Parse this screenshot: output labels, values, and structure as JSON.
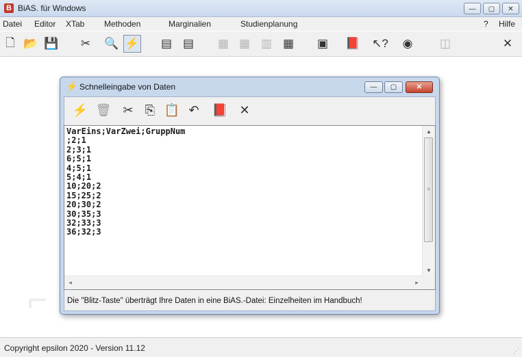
{
  "window": {
    "title": "BiAS. für Windows",
    "icon": "bias-app-icon",
    "icon_glyph": "B",
    "controls": {
      "minimize": "—",
      "maximize": "▢",
      "close": "✕"
    }
  },
  "menu": {
    "items": [
      {
        "label": "Datei"
      },
      {
        "label": "Editor"
      },
      {
        "label": "XTab"
      },
      {
        "label": "Methoden"
      },
      {
        "label": "Marginalien"
      },
      {
        "label": "Studienplanung"
      }
    ],
    "help_q": "?",
    "help": "Hilfe"
  },
  "toolbar": {
    "buttons": [
      {
        "icon": "new-document-icon",
        "glyph": "🗋",
        "state": "enabled"
      },
      {
        "icon": "open-folder-icon",
        "glyph": "📂",
        "state": "enabled"
      },
      {
        "icon": "save-icon",
        "glyph": "💾",
        "state": "enabled"
      },
      {
        "icon": "tools-icon",
        "glyph": "✂",
        "state": "enabled"
      },
      {
        "icon": "binoculars-icon",
        "glyph": "🔍",
        "state": "enabled"
      },
      {
        "icon": "quick-entry-icon",
        "glyph": "⚡",
        "state": "pressed"
      },
      {
        "icon": "check-list-icon",
        "glyph": "▤",
        "state": "enabled"
      },
      {
        "icon": "check-list-green-icon",
        "glyph": "▤",
        "state": "enabled"
      },
      {
        "icon": "document-disabled-icon",
        "glyph": "▦",
        "state": "disabled"
      },
      {
        "icon": "document-copy-disabled-icon",
        "glyph": "▦",
        "state": "disabled"
      },
      {
        "icon": "bar-chart-disabled-icon",
        "glyph": "▥",
        "state": "disabled"
      },
      {
        "icon": "document-icon",
        "glyph": "▦",
        "state": "enabled"
      },
      {
        "icon": "calculator-icon",
        "glyph": "▣",
        "state": "enabled"
      },
      {
        "icon": "handbook-icon",
        "glyph": "📕",
        "state": "enabled"
      },
      {
        "icon": "help-cursor-icon",
        "glyph": "↖?",
        "state": "enabled"
      },
      {
        "icon": "globe-icon",
        "glyph": "◉",
        "state": "enabled"
      },
      {
        "icon": "window-disabled-icon",
        "glyph": "◫",
        "state": "disabled"
      },
      {
        "icon": "close-icon",
        "glyph": "✕",
        "state": "enabled"
      }
    ]
  },
  "dialog": {
    "title": "Schnelleingabe von Daten",
    "title_icon": "lightning-icon",
    "title_icon_glyph": "⚡",
    "controls": {
      "minimize": "—",
      "maximize": "▢",
      "close": "✕"
    },
    "toolbar": [
      {
        "icon": "lightning-icon",
        "glyph": "⚡"
      },
      {
        "icon": "trash-icon",
        "glyph": "🗑"
      },
      {
        "icon": "cut-icon",
        "glyph": "✂"
      },
      {
        "icon": "copy-icon",
        "glyph": "⎘"
      },
      {
        "icon": "paste-icon",
        "glyph": "📋"
      },
      {
        "icon": "undo-icon",
        "glyph": "↶"
      },
      {
        "icon": "handbook-icon",
        "glyph": "📕"
      },
      {
        "icon": "close-icon",
        "glyph": "✕"
      }
    ],
    "lines": [
      "VarEins;VarZwei;GruppNum",
      ";2;1",
      "2;3;1",
      "6;5;1",
      "4;5;1",
      "5;4;1",
      "10;20;2",
      "15;25;2",
      "20;30;2",
      "30;35;3",
      "32;33;3",
      "36;32;3"
    ],
    "hint": "Die \"Blitz-Taste\" überträgt Ihre Daten in eine BiAS.-Datei: Einzelheiten im Handbuch!"
  },
  "status": {
    "text": "Copyright epsilon 2020 - Version 11.12"
  }
}
